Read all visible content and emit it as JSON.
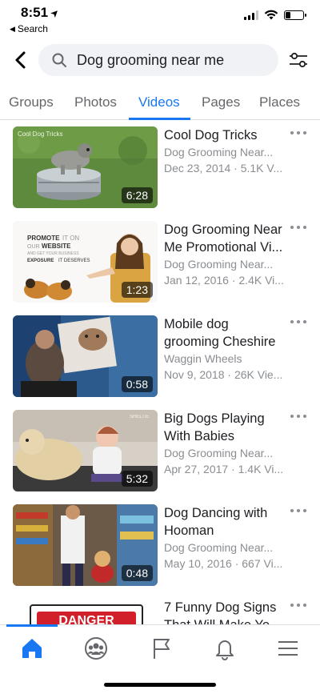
{
  "status_bar": {
    "time": "8:51",
    "back_label": "Search"
  },
  "search": {
    "query": "Dog grooming near me",
    "icons": {
      "back": "chevron-left-icon",
      "search": "search-icon",
      "filter": "filter-sliders-icon"
    }
  },
  "tabs": [
    {
      "label": "Groups",
      "active": false
    },
    {
      "label": "Photos",
      "active": false
    },
    {
      "label": "Videos",
      "active": true
    },
    {
      "label": "Pages",
      "active": false
    },
    {
      "label": "Places",
      "active": false
    }
  ],
  "results": [
    {
      "title": "Cool Dog Tricks",
      "channel": "Dog Grooming Near...",
      "meta": "Dec 23, 2014 · 5.1K V...",
      "duration": "6:28"
    },
    {
      "title": "Dog Grooming Near Me  Promotional Vi...",
      "channel": "Dog Grooming Near...",
      "meta": "Jan 12, 2016 · 2.4K Vi...",
      "duration": "1:23"
    },
    {
      "title": "Mobile dog grooming Cheshire",
      "channel": "Waggin Wheels",
      "meta": "Nov 9, 2018 · 26K Vie...",
      "duration": "0:58"
    },
    {
      "title": "Big Dogs Playing With Babies",
      "channel": "Dog Grooming Near...",
      "meta": "Apr 27, 2017 · 1.4K Vi...",
      "duration": "5:32"
    },
    {
      "title": "Dog Dancing with Hooman",
      "channel": "Dog Grooming Near...",
      "meta": "May 10, 2016 · 667 Vi...",
      "duration": "0:48"
    },
    {
      "title": "7 Funny Dog Signs That Will Make Yo...",
      "channel": "",
      "meta": "",
      "duration": ""
    }
  ],
  "thumb_text": {
    "t1_caption": "Cool Dog Tricks",
    "t2_line1a": "PROMOTE",
    "t2_line1b": "IT ON",
    "t2_line2a": "OUR",
    "t2_line2b": "WEBSITE",
    "t2_line3": "AND GET YOUR BUSINESS",
    "t2_line4a": "EXPOSURE",
    "t2_line4b": "IT DESERVES",
    "t4_corner": "SHELTIE",
    "t6_sign": "DANGER"
  },
  "bottom_nav": [
    {
      "icon": "home-icon",
      "active": true
    },
    {
      "icon": "groups-icon",
      "active": false
    },
    {
      "icon": "flag-icon",
      "active": false
    },
    {
      "icon": "bell-icon",
      "active": false
    },
    {
      "icon": "menu-icon",
      "active": false
    }
  ],
  "colors": {
    "accent": "#1877f2",
    "secondary_text": "#8a8d91",
    "search_bg": "#f0f2f5"
  }
}
